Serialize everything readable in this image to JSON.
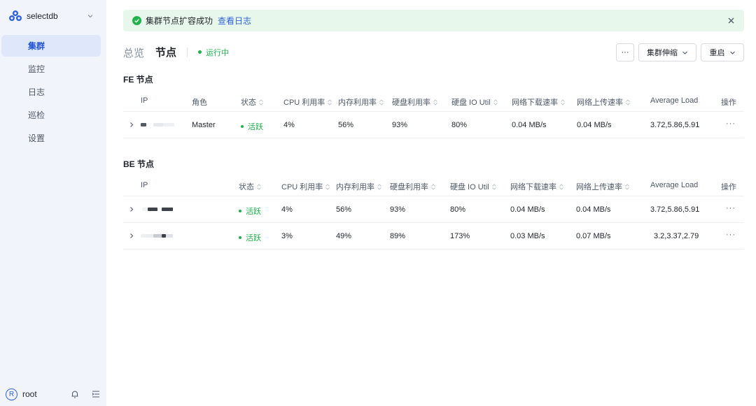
{
  "sidebar": {
    "brand": "selectdb",
    "items": [
      {
        "label": "集群",
        "active": true
      },
      {
        "label": "监控",
        "active": false
      },
      {
        "label": "日志",
        "active": false
      },
      {
        "label": "巡检",
        "active": false
      },
      {
        "label": "设置",
        "active": false
      }
    ],
    "user": {
      "avatar": "R",
      "name": "root"
    }
  },
  "toast": {
    "message": "集群节点扩容成功",
    "link": "查看日志"
  },
  "header": {
    "crumb_overview": "总览",
    "crumb_nodes": "节点",
    "status": "运行中",
    "more_label": "···",
    "scale_label": "集群伸缩",
    "restart_label": "重启"
  },
  "fe": {
    "title": "FE 节点",
    "columns": {
      "ip": "IP",
      "role": "角色",
      "status": "状态",
      "cpu": "CPU 利用率",
      "mem": "内存利用率",
      "disk": "硬盘利用率",
      "io": "硬盘 IO Util",
      "down": "网络下载速率",
      "up": "网络上传速率",
      "load": "Average Load",
      "ops": "操作"
    },
    "rows": [
      {
        "role": "Master",
        "status": "活跃",
        "cpu": "4%",
        "mem": "56%",
        "disk": "93%",
        "io": "80%",
        "down": "0.04 MB/s",
        "up": "0.04 MB/s",
        "load": "3.72,5.86,5.91",
        "ops": "···"
      }
    ]
  },
  "be": {
    "title": "BE 节点",
    "columns": {
      "ip": "IP",
      "status": "状态",
      "cpu": "CPU 利用率",
      "mem": "内存利用率",
      "disk": "硬盘利用率",
      "io": "硬盘 IO Util",
      "down": "网络下载速率",
      "up": "网络上传速率",
      "load": "Average Load",
      "ops": "操作"
    },
    "rows": [
      {
        "status": "活跃",
        "cpu": "4%",
        "mem": "56%",
        "disk": "93%",
        "io": "80%",
        "down": "0.04 MB/s",
        "up": "0.04 MB/s",
        "load": "3.72,5.86,5.91",
        "ops": "···"
      },
      {
        "status": "活跃",
        "cpu": "3%",
        "mem": "49%",
        "disk": "89%",
        "io": "173%",
        "down": "0.03 MB/s",
        "up": "0.07 MB/s",
        "load": "3.2,3.37,2.79",
        "ops": "···"
      }
    ]
  },
  "colors": {
    "accent": "#2f62e0",
    "success": "#20b34a",
    "sidebar_bg": "#f1f4fb",
    "toast_bg": "#e8f7ec"
  }
}
